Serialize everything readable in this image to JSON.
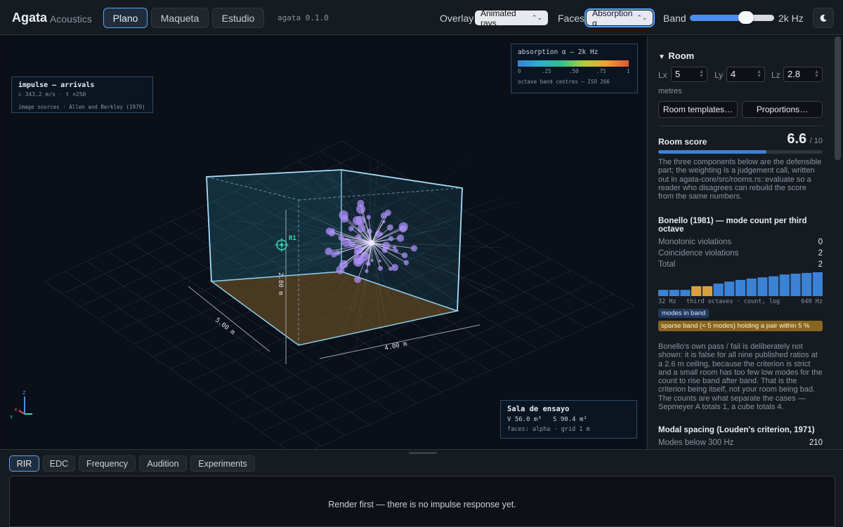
{
  "header": {
    "brand": "Agata",
    "brand_sub": "Acoustics",
    "nav": [
      "Plano",
      "Maqueta",
      "Estudio"
    ],
    "active_nav": "Plano",
    "version": "agata 0.1.0",
    "overlay_label": "Overlay",
    "overlay_value": "Animated rays",
    "faces_label": "Faces",
    "faces_value": "Absorption α",
    "band_label": "Band",
    "band_slider_fraction": 0.68,
    "band_value": "2k Hz",
    "theme_icon": "moon-icon"
  },
  "viewport": {
    "impulse_title": "impulse — arrivals",
    "impulse_sub": "c 343.2 m/s · t ×250",
    "impulse_note": "image sources · Allen and Berkley (1979)",
    "abs_title": "absorption α — 2k Hz",
    "abs_ticks": [
      "0",
      ".25",
      ".50",
      ".75",
      "1"
    ],
    "abs_note": "octave band centres — ISO 266",
    "receiver_label": "R1",
    "dim_height": "2.80 m",
    "dim_length": "5.00 m",
    "dim_width": "4.00 m",
    "room_name": "Sala de ensayo",
    "room_stats": "V 56.0 m³   S 90.4 m²",
    "room_note": "faces: alpha · grid 1 m",
    "axis_labels": {
      "z": "Z",
      "x": "X",
      "y": "Y"
    },
    "colors": {
      "room_edge": "#8fd0f0",
      "ray": "#a98cf5",
      "floor": "#5a4a2a",
      "receiver": "#3dd6b5"
    }
  },
  "panel": {
    "room_title": "Room",
    "dims": [
      {
        "label": "Lx",
        "value": "5"
      },
      {
        "label": "Ly",
        "value": "4"
      },
      {
        "label": "Lz",
        "value": "2.8"
      }
    ],
    "units": "metres",
    "btn_templates": "Room templates…",
    "btn_proportions": "Proportions…",
    "score_label": "Room score",
    "score_value": "6.6",
    "score_max": "/ 10",
    "score_fraction": 0.66,
    "score_text": "The three components below are the defensible part; the weighting is a judgement call, written out in agata-core/src/rooms.rs::evaluate so a reader who disagrees can rebuild the score from the same numbers.",
    "bonello_title": "Bonello (1981) — mode count per third octave",
    "bonello_rows": [
      {
        "label": "Monotonic violations",
        "value": "0"
      },
      {
        "label": "Coincidence violations",
        "value": "2"
      },
      {
        "label": "Total",
        "value": "2"
      }
    ],
    "bar_values": [
      1,
      1,
      1,
      2,
      2,
      3,
      4,
      5,
      6,
      7,
      8,
      10,
      11,
      12,
      13
    ],
    "bar_highlight": [
      3,
      4
    ],
    "bar_axis_left": "32 Hz",
    "bar_axis_mid": "third octaves · count, log",
    "bar_axis_right": "640 Hz",
    "badge_modes": "modes in band",
    "badge_sparse": "sparse band (< 5 modes) holding a pair within 5 %",
    "bonello_text": "Bonello's own pass / fail is deliberately not shown: it is false for all nine published ratios at a 2.6 m ceiling, because the criterion is strict and a small room has too few low modes for the count to rise band after band. That is the criterion being itself, not your room being bad. The counts are what separate the cases — Sepmeyer A totals 1, a cube totals 4.",
    "modal_title": "Modal spacing (Louden's criterion, 1971)",
    "modal_rows": [
      {
        "label": "Modes below 300 Hz",
        "value": "210"
      }
    ],
    "colors": {
      "bar": "#3b82d6",
      "bar_hl": "#d9a042",
      "score": "#3b82d6"
    }
  },
  "bottom": {
    "tabs": [
      "RIR",
      "EDC",
      "Frequency",
      "Audition",
      "Experiments"
    ],
    "active_tab": "RIR",
    "message": "Render first — there is no impulse response yet."
  }
}
